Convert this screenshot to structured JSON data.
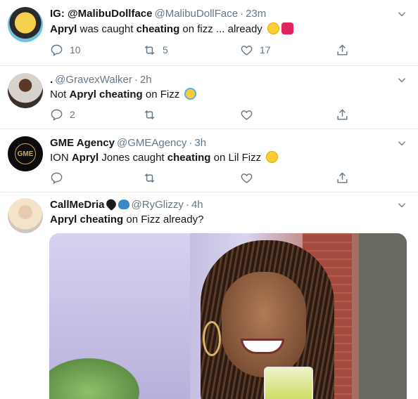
{
  "tweets": [
    {
      "display_name": "IG: @MalibuDollface",
      "handle": "@MalibuDollFace",
      "time": "23m",
      "text": {
        "p1": "Apryl",
        "p2": " was caught ",
        "p3": "cheating",
        "p4": " on fizz ... already"
      },
      "emojis": [
        "rolling-laughing-emoji",
        "revolving-heart-emoji"
      ],
      "reply_count": "10",
      "retweet_count": "5",
      "like_count": "17"
    },
    {
      "display_name": ".",
      "handle": "@GravexWalker",
      "time": "2h",
      "text": {
        "p1": "Not ",
        "p2": "Apryl",
        "p3": " ",
        "p4": "cheating",
        "p5": " on Fizz"
      },
      "emojis": [
        "loudly-crying-emoji"
      ],
      "reply_count": "2",
      "retweet_count": "",
      "like_count": ""
    },
    {
      "display_name": "GME Agency",
      "handle": "@GMEAgency",
      "time": "3h",
      "avatar_text": "GME",
      "text": {
        "p1": "ION ",
        "p2": "Apryl",
        "p3": " Jones caught ",
        "p4": "cheating",
        "p5": " on Lil Fizz"
      },
      "emojis": [
        "pleading-face-emoji"
      ],
      "reply_count": "",
      "retweet_count": "",
      "like_count": ""
    },
    {
      "display_name": "CallMeDria",
      "handle": "@RyGlizzy",
      "time": "4h",
      "name_emojis": [
        "black-heart-emoji",
        "butterfly-emoji"
      ],
      "text": {
        "p1": "Apryl",
        "p2": " ",
        "p3": "cheating",
        "p4": " on Fizz already?"
      }
    }
  ],
  "colors": {
    "meta": "#657786",
    "divider": "#e6ecf0",
    "text": "#14171a"
  },
  "icons": [
    "reply-icon",
    "retweet-icon",
    "like-icon",
    "share-icon",
    "chevron-down-icon"
  ]
}
